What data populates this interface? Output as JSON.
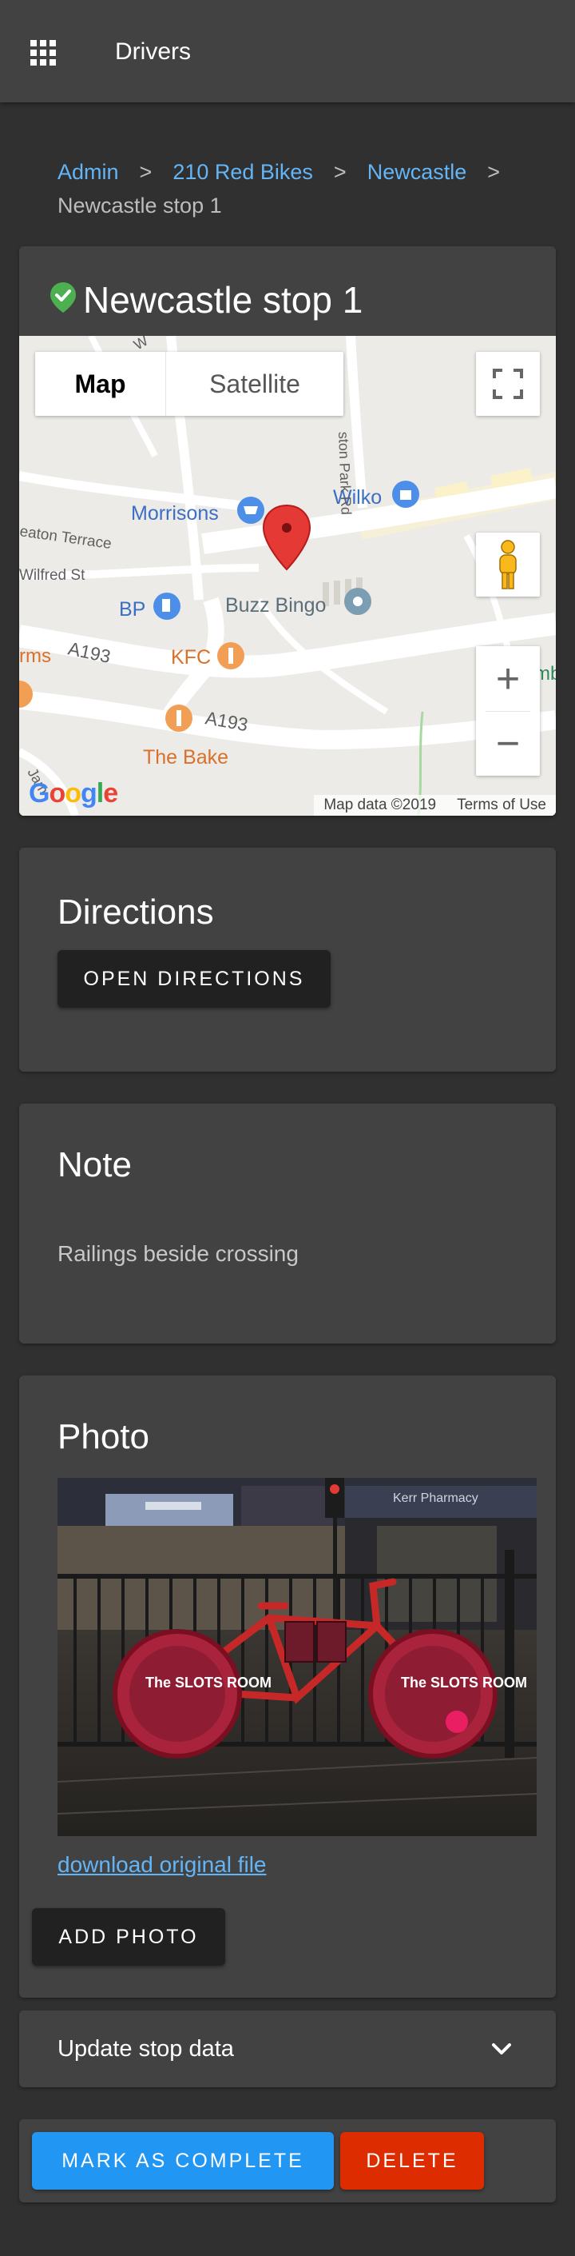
{
  "appbar": {
    "title": "Drivers",
    "menu_icon": "apps-grid-icon"
  },
  "breadcrumb": {
    "items": [
      "Admin",
      "210 Red Bikes",
      "Newcastle"
    ],
    "separator": ">",
    "current": "Newcastle stop 1"
  },
  "stop": {
    "title": "Newcastle stop 1",
    "status_icon": "verified-check-icon",
    "status_color": "#4caf50"
  },
  "map": {
    "type_buttons": [
      "Map",
      "Satellite"
    ],
    "selected_type": "Map",
    "zoom_in": "+",
    "zoom_out": "−",
    "logo": "Google",
    "attribution": "Map data ©2019",
    "terms": "Terms of Use",
    "places": {
      "morrisons": "Morrisons",
      "wilko": "Wilko",
      "buzz_bingo": "Buzz Bingo",
      "bp": "BP",
      "kfc": "KFC",
      "the_bake": "The Bake",
      "eaton_terrace": "eaton Terrace",
      "wilfred_st": "Wilfred St",
      "a193_west": "A193",
      "a193_east": "A193",
      "park_rd": "ston Park Rd",
      "rms": "rms",
      "wi_edge": "Wi",
      "jam_edge": "Jam",
      "w_edge": "W",
      "mb_edge": "mb"
    }
  },
  "directions": {
    "title": "Directions",
    "button": "OPEN DIRECTIONS"
  },
  "note": {
    "title": "Note",
    "text": "Railings beside crossing"
  },
  "photo": {
    "title": "Photo",
    "download_link": "download original file",
    "add_button": "ADD PHOTO",
    "sign_text": "The SLOTS ROOM",
    "store_text": "Kerr Pharmacy"
  },
  "update": {
    "label": "Update stop data"
  },
  "actions": {
    "complete": "MARK AS COMPLETE",
    "delete": "DELETE",
    "complete_color": "#2196f3",
    "delete_color": "#dd2c00"
  }
}
